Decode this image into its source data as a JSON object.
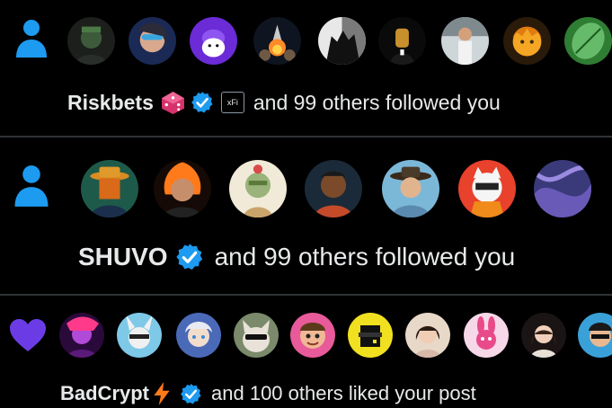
{
  "colors": {
    "accent": "#1d9bf0",
    "like": "#6b3ce6",
    "background": "#000000",
    "text": "#e7e9ea",
    "divider": "#2f3336"
  },
  "notifications": [
    {
      "type": "follow",
      "icon": "person-icon",
      "username": "Riskbets",
      "emoji": "dice-icon",
      "affiliate_badge": "xFi",
      "rest_text": "and 99 others followed you"
    },
    {
      "type": "follow",
      "icon": "person-icon",
      "username": "SHUVO",
      "rest_text": "and 99 others followed you"
    },
    {
      "type": "like",
      "icon": "heart-icon",
      "username": "BadCrypt",
      "emoji": "lightning-icon",
      "rest_text": "and 100 others liked your post"
    }
  ]
}
